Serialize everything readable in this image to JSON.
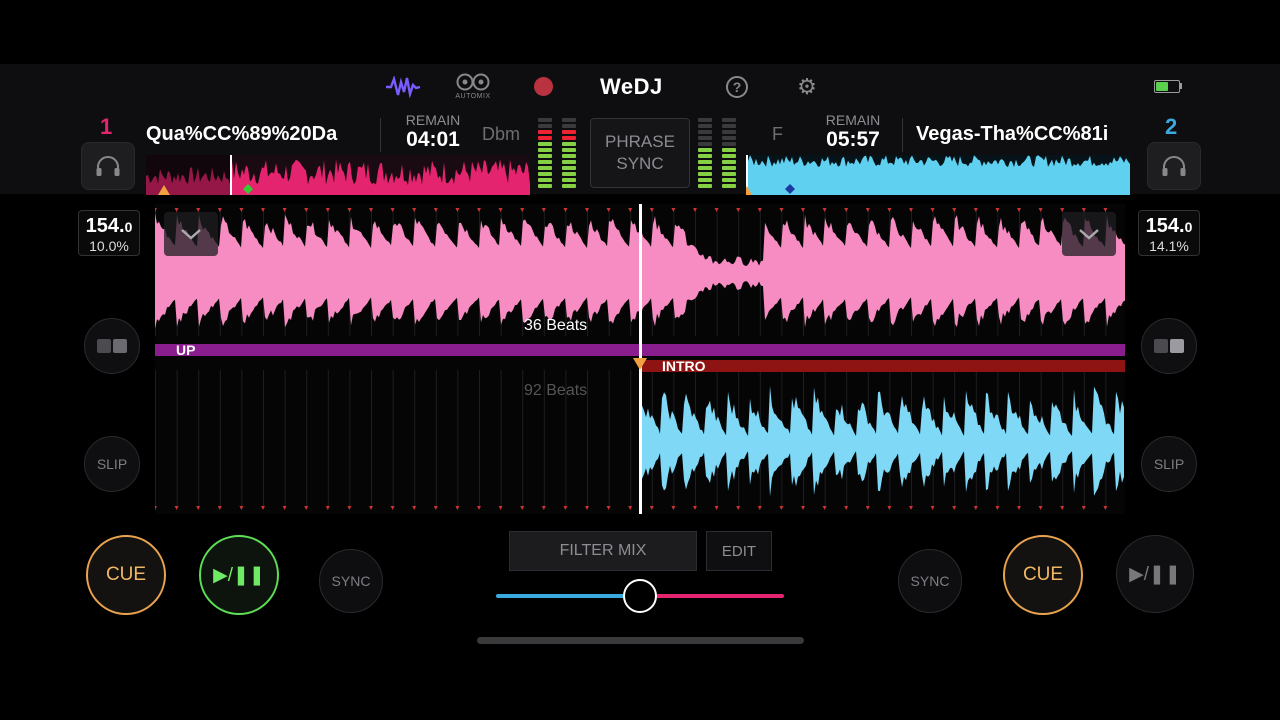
{
  "header": {
    "app_name": "WeDJ",
    "automix_label": "AUTOMIX",
    "icons": [
      "waveform-icon",
      "automix-icon",
      "record-icon",
      "help-icon",
      "gear-icon",
      "battery-icon"
    ]
  },
  "deck1": {
    "number": "1",
    "title": "Qua%CC%89%20Da",
    "remain_label": "REMAIN",
    "remain_time": "04:01",
    "key": "Dbm",
    "bpm_int": "154.",
    "bpm_dec": "0",
    "pitch": "10.0%",
    "beats_label": "36 Beats",
    "phrase_label": "UP",
    "color": "#ff6fb0"
  },
  "deck2": {
    "number": "2",
    "title": "Vegas-Tha%CC%81i",
    "remain_label": "REMAIN",
    "remain_time": "05:57",
    "key": "F",
    "bpm_int": "154.",
    "bpm_dec": "0",
    "pitch": "14.1%",
    "beats_label": "92 Beats",
    "phrase_label": "INTRO",
    "color": "#5fd0f0"
  },
  "center": {
    "phrase_sync_line1": "PHRASE",
    "phrase_sync_line2": "SYNC",
    "filter_mix_label": "FILTER MIX",
    "edit_label": "EDIT",
    "crossfader_value": 0.5
  },
  "buttons": {
    "cue": "CUE",
    "play_pause": "▶/❚❚",
    "sync": "SYNC",
    "slip": "SLIP"
  },
  "colors": {
    "accent_pink": "#e4246e",
    "accent_blue": "#3aa9e0",
    "cue_orange": "#e9a34f",
    "play_green": "#5ddf55"
  }
}
